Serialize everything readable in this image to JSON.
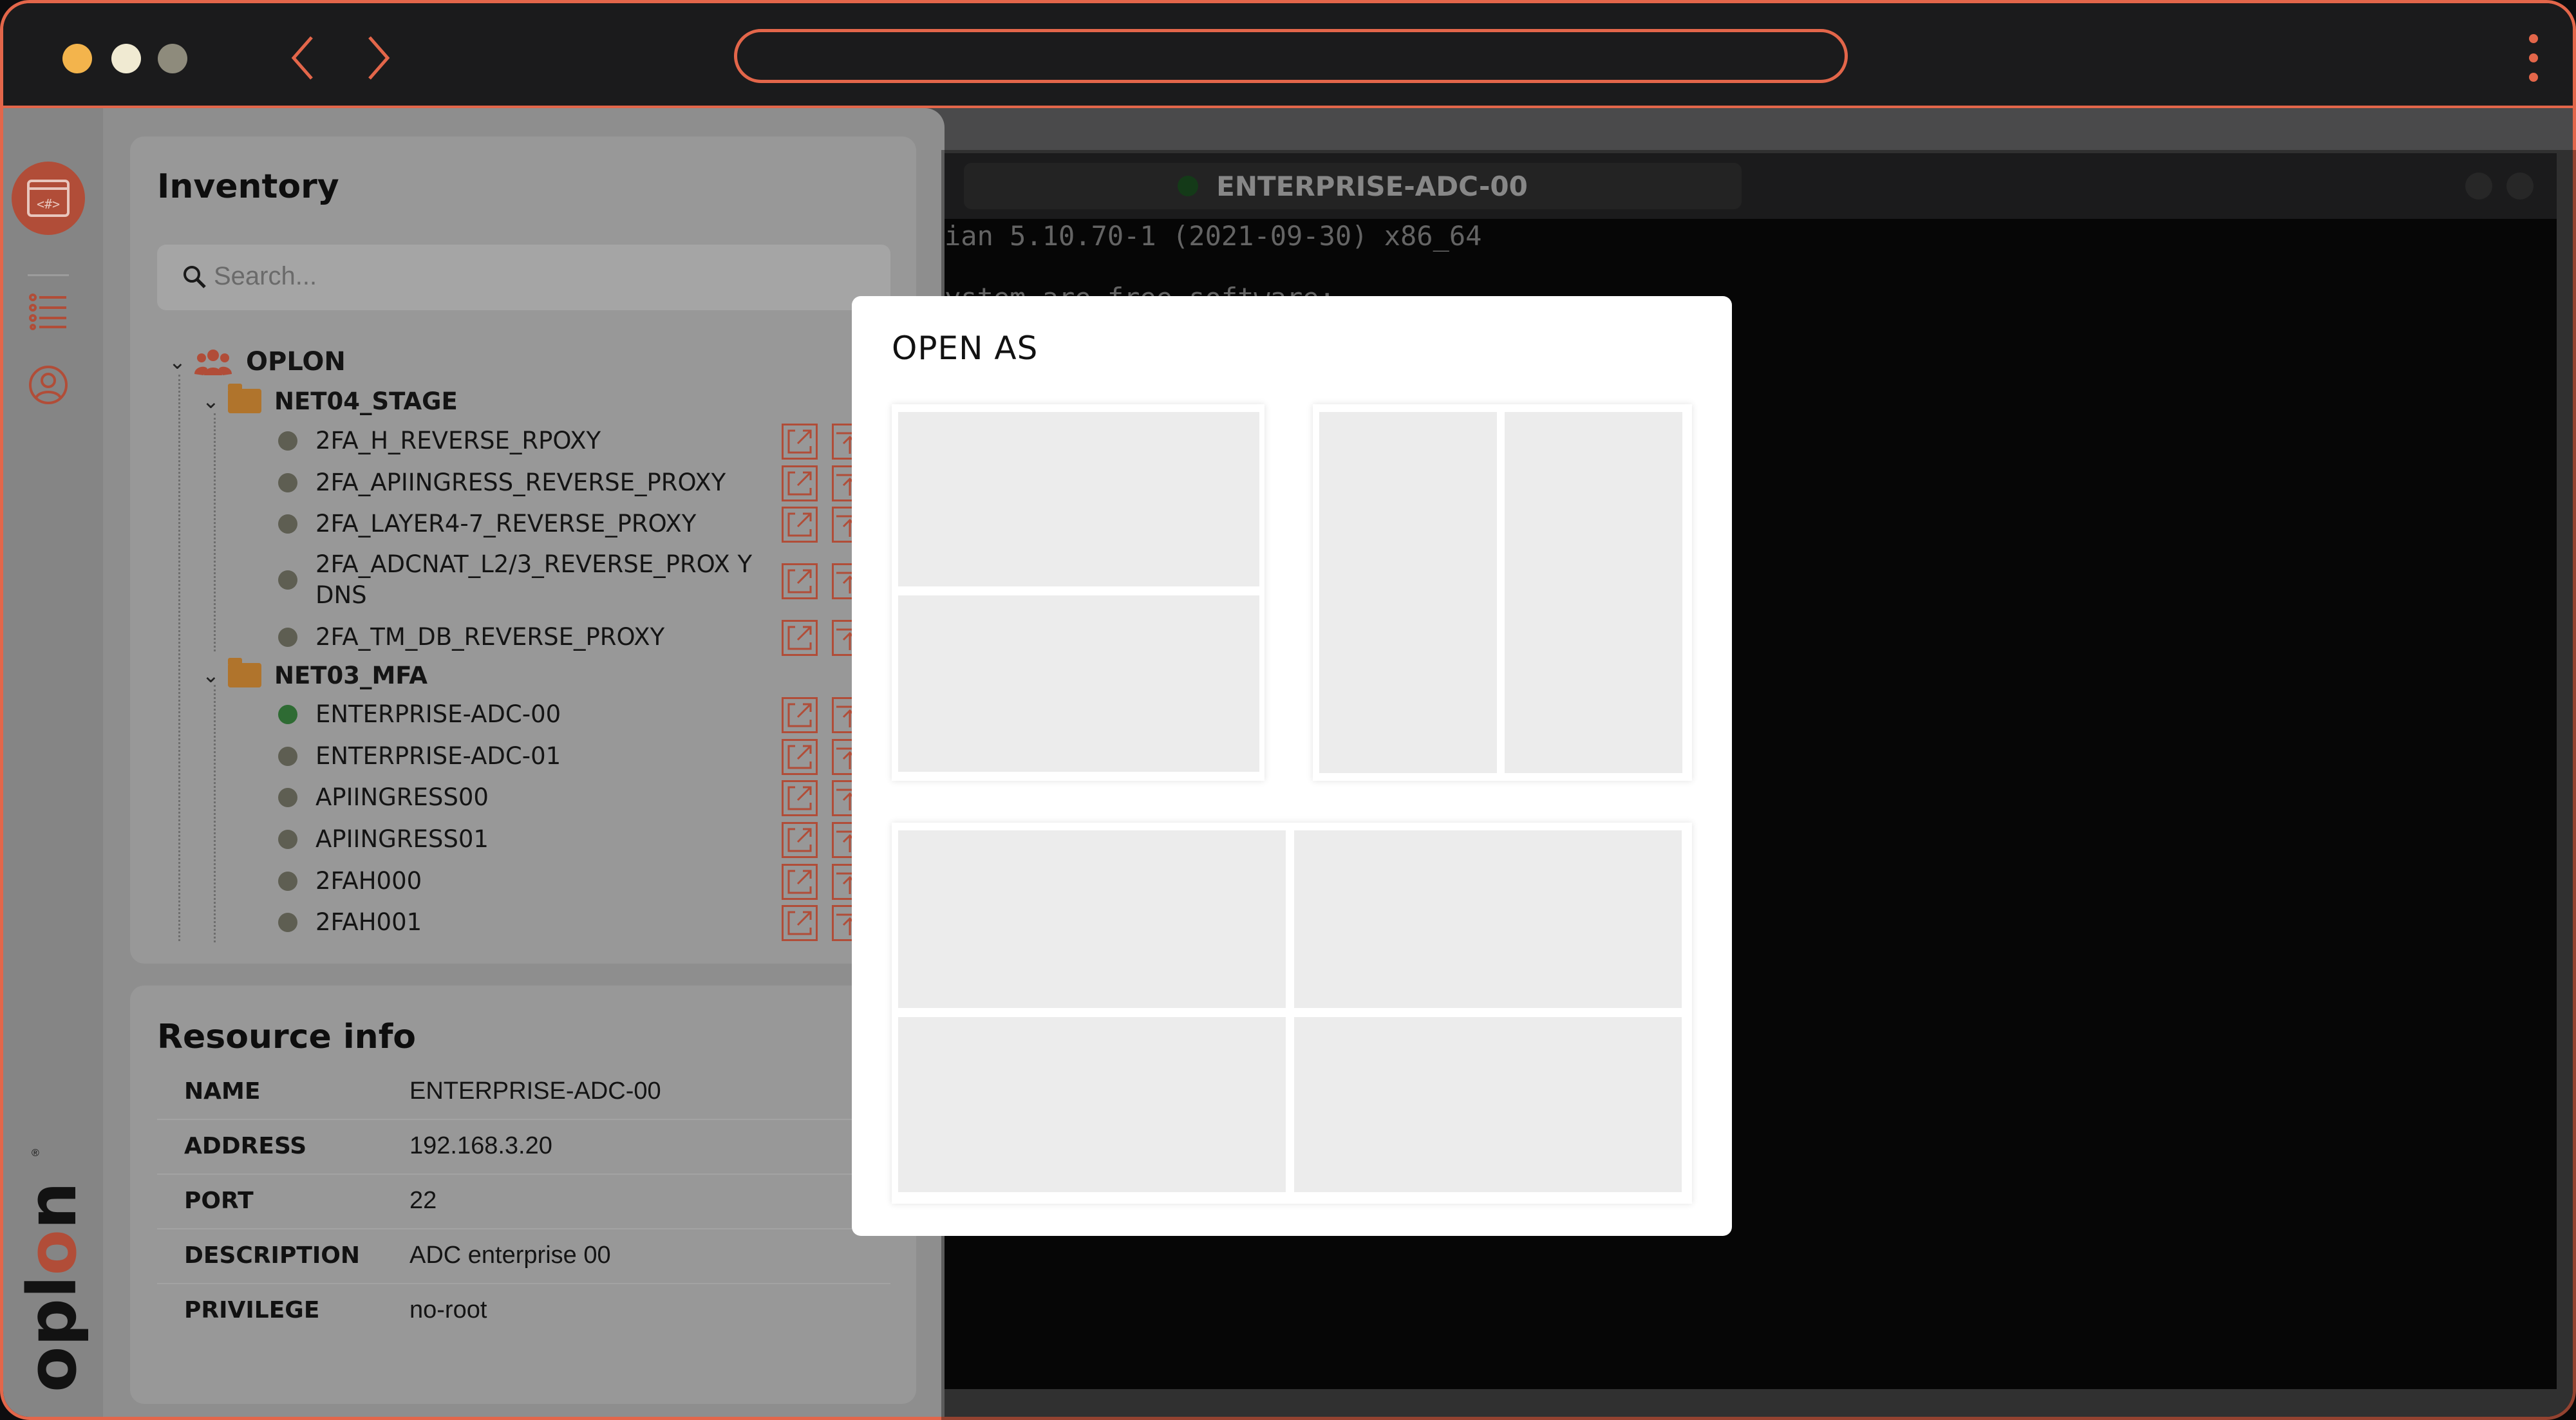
{
  "browser": {
    "traffic_lights": [
      "#f3b44c",
      "#f0ead2",
      "#8e8b7c"
    ],
    "accent": "#e3664a",
    "back_icon": "chevron-left-icon",
    "forward_icon": "chevron-right-icon",
    "url": "",
    "menu_icon": "kebab-menu-icon"
  },
  "rail": {
    "app_icon": "terminal-app-icon",
    "items": [
      "list-icon",
      "user-icon"
    ],
    "logo_text": "oplon",
    "logo_mark": "®"
  },
  "inventory": {
    "title": "Inventory",
    "search_placeholder": "Search...",
    "root": {
      "label": "OPLON",
      "icon": "group-icon"
    },
    "groups": [
      {
        "label": "NET04_STAGE",
        "items": [
          {
            "label": "2FA_H_REVERSE_RPOXY",
            "online": false
          },
          {
            "label": "2FA_APIINGRESS_REVERSE_PROXY",
            "online": false
          },
          {
            "label": "2FA_LAYER4-7_REVERSE_PROXY",
            "online": false
          },
          {
            "label": "2FA_ADCNAT_L2/3_REVERSE_PROX Y DNS",
            "online": false
          },
          {
            "label": "2FA_TM_DB_REVERSE_PROXY",
            "online": false
          }
        ]
      },
      {
        "label": "NET03_MFA",
        "items": [
          {
            "label": "ENTERPRISE-ADC-00",
            "online": true
          },
          {
            "label": "ENTERPRISE-ADC-01",
            "online": false
          },
          {
            "label": "APIINGRESS00",
            "online": false
          },
          {
            "label": "APIINGRESS01",
            "online": false
          },
          {
            "label": "2FAH000",
            "online": false
          },
          {
            "label": "2FAH001",
            "online": false
          }
        ]
      }
    ]
  },
  "resource_info": {
    "title": "Resource info",
    "rows": [
      {
        "key": "NAME",
        "value": "ENTERPRISE-ADC-00"
      },
      {
        "key": "ADDRESS",
        "value": "192.168.3.20"
      },
      {
        "key": "PORT",
        "value": "22"
      },
      {
        "key": "DESCRIPTION",
        "value": "ADC enterprise 00"
      },
      {
        "key": "PRIVILEGE",
        "value": "no-root"
      }
    ]
  },
  "terminal": {
    "tab_title": "ENTERPRISE-ADC-00",
    "lines": [
      "ian 5.10.70-1 (2021-09-30) x86_64",
      "",
      "ystem are free software;"
    ]
  },
  "modal": {
    "title": "OPEN AS",
    "options": [
      "layout-two-horizontal",
      "layout-two-vertical",
      "layout-four-grid"
    ]
  }
}
